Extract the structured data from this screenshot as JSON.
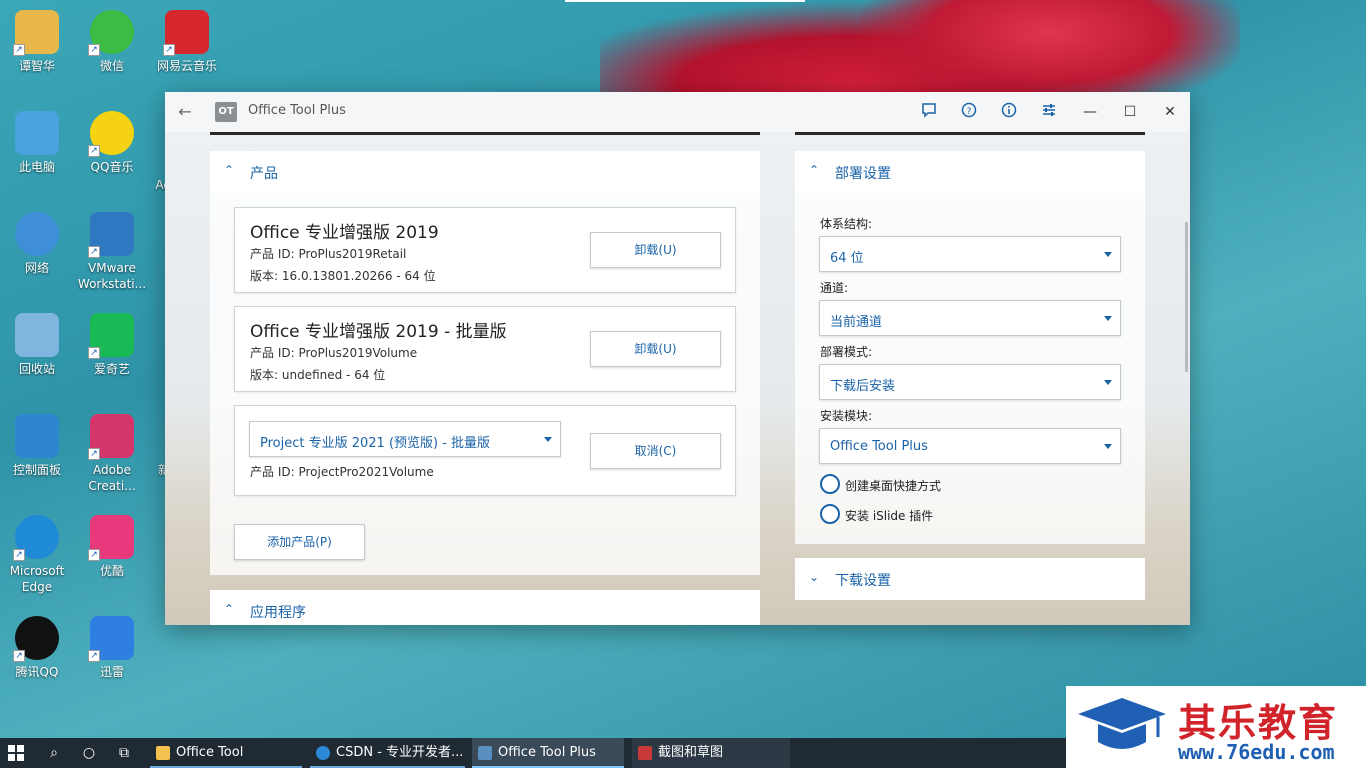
{
  "desktop": {
    "icons": [
      {
        "label": "谭智华",
        "color": "#e8b94a"
      },
      {
        "label": "微信",
        "color": "#3dbb43"
      },
      {
        "label": "网易云音乐",
        "color": "#d8262f"
      },
      {
        "label": "此电脑",
        "color": "#4aa3df"
      },
      {
        "label": "QQ音乐",
        "color": "#f5d312"
      },
      {
        "label": "网络",
        "color": "#3f8fd8"
      },
      {
        "label": "VMware Workstati...",
        "color": "#2e78c2"
      },
      {
        "label": "回收站",
        "color": "#7fb6e0"
      },
      {
        "label": "爱奇艺",
        "color": "#19b955"
      },
      {
        "label": "控制面板",
        "color": "#2d86cf"
      },
      {
        "label": "Adobe Creati...",
        "color": "#d4366b"
      },
      {
        "label": "Microsoft Edge",
        "color": "#1f8ad6"
      },
      {
        "label": "优酷",
        "color": "#e8397d"
      },
      {
        "label": "腾讯QQ",
        "color": "#111111"
      },
      {
        "label": "迅雷",
        "color": "#2f7fe3"
      }
    ],
    "partial_labels": {
      "ac": "Ac",
      "xin": "新"
    }
  },
  "window": {
    "title": "Office Tool Plus",
    "logo_text": "OT",
    "toolbar_icons": [
      "feedback-icon",
      "help-icon",
      "info-icon",
      "settings-icon"
    ],
    "controls": {
      "minimize": "—",
      "maximize": "☐",
      "close": "✕"
    }
  },
  "products_panel": {
    "header": "产品",
    "items": [
      {
        "name": "Office 专业增强版 2019",
        "product_id": "产品 ID: ProPlus2019Retail",
        "version": "版本: 16.0.13801.20266 - 64 位",
        "button": "卸载(U)"
      },
      {
        "name": "Office 专业增强版 2019 - 批量版",
        "product_id": "产品 ID: ProPlus2019Volume",
        "version": "版本: undefined - 64 位",
        "button": "卸载(U)"
      }
    ],
    "pending": {
      "select_value": "Project 专业版 2021 (预览版) - 批量版",
      "product_id": "产品 ID: ProjectPro2021Volume",
      "button": "取消(C)"
    },
    "add_button": "添加产品(P)"
  },
  "apps_panel": {
    "header": "应用程序"
  },
  "deploy_panel": {
    "header": "部署设置",
    "fields": [
      {
        "label": "体系结构:",
        "value": "64 位"
      },
      {
        "label": "通道:",
        "value": "当前通道"
      },
      {
        "label": "部署模式:",
        "value": "下载后安装"
      },
      {
        "label": "安装模块:",
        "value": "Office Tool Plus"
      }
    ],
    "options": [
      "创建桌面快捷方式",
      "安装 iSlide 插件"
    ]
  },
  "download_panel": {
    "header": "下载设置"
  },
  "taskbar": {
    "items": [
      {
        "label": "Office Tool",
        "color": "#f2c14e"
      },
      {
        "label": "CSDN - 专业开发者...",
        "color": "#2c89d8"
      },
      {
        "label": "Office Tool Plus",
        "color": "#5a8fc2"
      },
      {
        "label": "截图和草图",
        "color": "#c83a3a"
      }
    ]
  },
  "watermark": {
    "title": "其乐教育",
    "url": "www.76edu.com"
  }
}
